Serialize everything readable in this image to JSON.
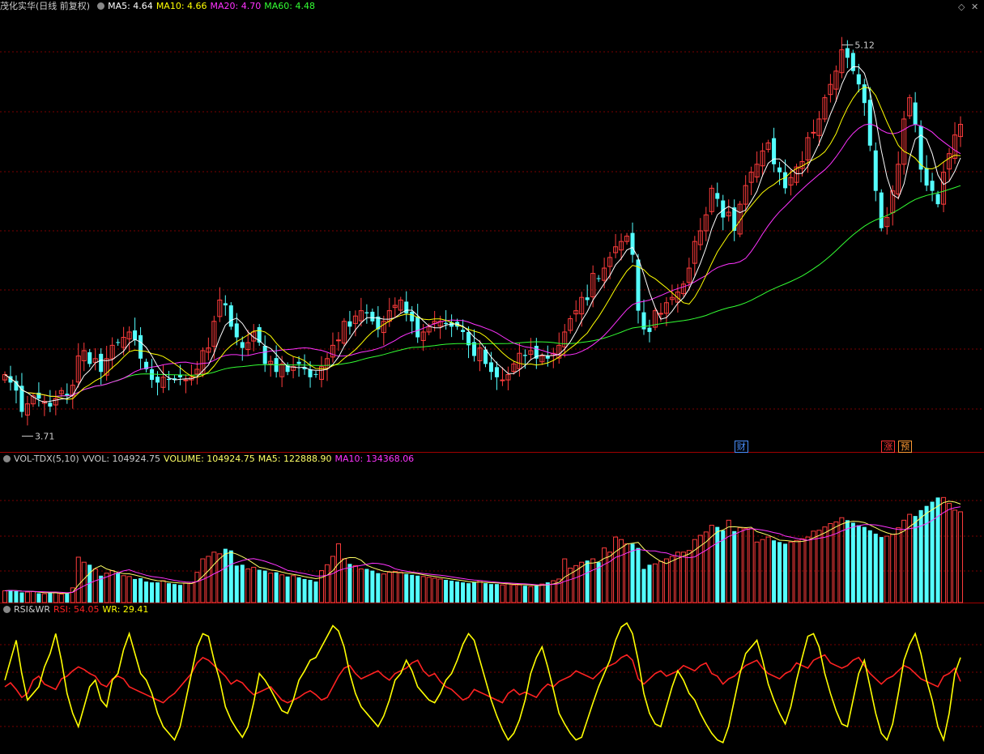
{
  "window_controls": {
    "diamond": "◇",
    "close": "✕"
  },
  "main_panel": {
    "title": "茂化实华(日线 前复权)",
    "ma5": {
      "label": "MA5: 4.64",
      "color": "#ffffff"
    },
    "ma10": {
      "label": "MA10: 4.66",
      "color": "#ffff00"
    },
    "ma20": {
      "label": "MA20: 4.70",
      "color": "#ff33ff"
    },
    "ma60": {
      "label": "MA60: 4.48",
      "color": "#33ff33"
    },
    "high_label": "5.12",
    "low_label": "3.71",
    "markers": [
      {
        "text": "财",
        "color": "#4a90ff",
        "index": 130
      },
      {
        "text": "涨",
        "color": "#ff3333",
        "index": 156
      },
      {
        "text": "预",
        "color": "#ff9933",
        "index": 159
      }
    ]
  },
  "volume_panel": {
    "title": "VOL-TDX(5,10)",
    "vvol": "VVOL: 104924.75",
    "volume": {
      "label": "VOLUME: 104924.75",
      "color": "#ffff66"
    },
    "ma5": {
      "label": "MA5: 122888.90",
      "color": "#ffff66"
    },
    "ma10": {
      "label": "MA10: 134368.06",
      "color": "#ff33ff"
    }
  },
  "rsi_panel": {
    "title": "RSI&WR",
    "rsi": {
      "label": "RSI: 54.05",
      "color": "#ff2222"
    },
    "wr": {
      "label": "WR: 29.41",
      "color": "#ffff00"
    }
  },
  "colors": {
    "up": "#ff3c3c",
    "down": "#54ffff",
    "grid": "#7a0000",
    "separator": "#a00000"
  },
  "chart_data": {
    "type": "candlestick",
    "price_range": [
      3.6,
      5.2
    ],
    "closes": [
      3.86,
      3.83,
      3.8,
      3.72,
      3.75,
      3.78,
      3.77,
      3.76,
      3.74,
      3.77,
      3.8,
      3.78,
      3.82,
      3.93,
      3.95,
      3.9,
      3.92,
      3.87,
      3.92,
      3.97,
      3.98,
      4.0,
      4.02,
      3.99,
      3.92,
      3.88,
      3.84,
      3.83,
      3.85,
      3.84,
      3.84,
      3.85,
      3.84,
      3.85,
      3.88,
      3.95,
      3.96,
      4.06,
      4.14,
      4.12,
      4.04,
      4.0,
      3.96,
      3.98,
      4.02,
      3.98,
      3.9,
      3.91,
      3.87,
      3.9,
      3.87,
      3.89,
      3.9,
      3.88,
      3.85,
      3.86,
      3.89,
      3.92,
      3.97,
      3.99,
      4.06,
      4.04,
      4.08,
      4.1,
      4.09,
      4.06,
      4.03,
      4.06,
      4.1,
      4.12,
      4.14,
      4.09,
      4.06,
      4.0,
      4.02,
      4.04,
      4.06,
      4.06,
      4.05,
      4.04,
      4.04,
      4.02,
      3.97,
      3.93,
      3.96,
      3.9,
      3.87,
      3.85,
      3.84,
      3.86,
      3.9,
      3.94,
      3.93,
      3.95,
      3.92,
      3.93,
      3.92,
      3.94,
      3.97,
      4.02,
      4.07,
      4.1,
      4.15,
      4.14,
      4.24,
      4.22,
      4.26,
      4.3,
      4.34,
      4.36,
      4.38,
      4.31,
      4.1,
      4.03,
      4.02,
      4.1,
      4.09,
      4.13,
      4.15,
      4.17,
      4.2,
      4.26,
      4.36,
      4.4,
      4.46,
      4.56,
      4.52,
      4.45,
      4.47,
      4.4,
      4.5,
      4.57,
      4.62,
      4.65,
      4.7,
      4.73,
      4.65,
      4.62,
      4.56,
      4.6,
      4.64,
      4.66,
      4.75,
      4.77,
      4.82,
      4.9,
      4.95,
      5.0,
      5.08,
      5.05,
      5.0,
      4.95,
      4.88,
      4.72,
      4.55,
      4.41,
      4.45,
      4.55,
      4.65,
      4.82,
      4.9,
      4.8,
      4.63,
      4.57,
      4.55,
      4.5,
      4.62,
      4.69,
      4.76,
      4.8
    ],
    "volume_max": 160000,
    "volumes": [
      14000,
      15000,
      13500,
      12000,
      12500,
      13000,
      11000,
      10500,
      11500,
      12000,
      10000,
      11000,
      17500,
      54000,
      48000,
      45000,
      40000,
      32000,
      35000,
      38000,
      35000,
      32000,
      31000,
      28000,
      29000,
      25000,
      24000,
      24000,
      26000,
      23000,
      22000,
      21000,
      23000,
      24000,
      36000,
      52000,
      55000,
      60000,
      58000,
      64000,
      62000,
      44000,
      45000,
      40000,
      42000,
      39000,
      38000,
      35000,
      36000,
      33000,
      31000,
      32000,
      30000,
      28000,
      27000,
      25000,
      38000,
      45000,
      55000,
      70000,
      52000,
      46000,
      44000,
      40000,
      40000,
      38000,
      35000,
      34000,
      36000,
      37000,
      36000,
      34000,
      33000,
      32000,
      31000,
      30000,
      29000,
      28000,
      27000,
      26000,
      25000,
      24000,
      23000,
      24000,
      26000,
      23000,
      22000,
      22000,
      21000,
      23000,
      21000,
      21000,
      20000,
      19000,
      20000,
      22000,
      24000,
      26000,
      28000,
      52000,
      41000,
      44000,
      48000,
      50000,
      52000,
      48000,
      65000,
      60000,
      78000,
      75000,
      70000,
      70000,
      65000,
      40000,
      45000,
      46000,
      49000,
      52000,
      55000,
      60000,
      60000,
      62000,
      75000,
      80000,
      84000,
      92000,
      90000,
      86000,
      98000,
      85000,
      89000,
      88000,
      88000,
      72000,
      75000,
      78000,
      74000,
      72000,
      70000,
      72000,
      74000,
      76000,
      78000,
      85000,
      86000,
      90000,
      94000,
      96000,
      101000,
      98000,
      95000,
      92000,
      90000,
      86000,
      82000,
      78000,
      79000,
      81000,
      89000,
      98000,
      105000,
      103000,
      110000,
      115000,
      120000,
      125000,
      125000,
      118000,
      110000,
      108000
    ],
    "rsi_range": [
      0,
      100
    ],
    "rsi": [
      50,
      53,
      48,
      42,
      45,
      55,
      58,
      52,
      50,
      48,
      56,
      58,
      62,
      65,
      63,
      60,
      58,
      52,
      50,
      56,
      58,
      56,
      50,
      48,
      46,
      44,
      42,
      40,
      38,
      42,
      45,
      50,
      55,
      60,
      68,
      72,
      70,
      66,
      62,
      58,
      52,
      55,
      53,
      48,
      44,
      46,
      48,
      50,
      45,
      40,
      38,
      40,
      42,
      45,
      47,
      44,
      40,
      42,
      50,
      58,
      64,
      66,
      60,
      56,
      58,
      60,
      62,
      58,
      55,
      60,
      62,
      64,
      68,
      70,
      62,
      58,
      60,
      54,
      50,
      48,
      44,
      40,
      42,
      48,
      46,
      44,
      42,
      40,
      38,
      45,
      48,
      44,
      46,
      44,
      42,
      48,
      52,
      50,
      54,
      56,
      58,
      62,
      60,
      58,
      56,
      60,
      64,
      66,
      68,
      72,
      74,
      70,
      56,
      52,
      56,
      60,
      62,
      58,
      60,
      62,
      66,
      64,
      62,
      66,
      68,
      60,
      58,
      52,
      56,
      58,
      62,
      66,
      68,
      70,
      64,
      60,
      58,
      56,
      60,
      62,
      68,
      66,
      64,
      70,
      72,
      74,
      68,
      66,
      64,
      66,
      70,
      72,
      66,
      60,
      56,
      52,
      56,
      58,
      62,
      66,
      64,
      60,
      56,
      54,
      52,
      50,
      58,
      60,
      64,
      54
    ],
    "wr": [
      55,
      70,
      85,
      60,
      40,
      45,
      50,
      65,
      75,
      90,
      70,
      45,
      30,
      20,
      35,
      50,
      55,
      40,
      35,
      55,
      60,
      78,
      90,
      75,
      60,
      55,
      45,
      30,
      20,
      15,
      10,
      20,
      40,
      60,
      80,
      90,
      88,
      70,
      55,
      35,
      25,
      18,
      12,
      20,
      38,
      60,
      55,
      48,
      40,
      32,
      30,
      40,
      55,
      62,
      70,
      72,
      80,
      88,
      96,
      92,
      80,
      60,
      45,
      35,
      30,
      25,
      20,
      28,
      40,
      55,
      60,
      70,
      62,
      50,
      45,
      40,
      38,
      45,
      55,
      60,
      70,
      82,
      90,
      85,
      70,
      55,
      40,
      28,
      18,
      10,
      15,
      25,
      40,
      60,
      72,
      80,
      65,
      48,
      30,
      22,
      15,
      10,
      12,
      25,
      38,
      50,
      60,
      70,
      85,
      95,
      98,
      90,
      70,
      45,
      30,
      22,
      20,
      35,
      50,
      62,
      55,
      45,
      40,
      30,
      22,
      15,
      10,
      8,
      20,
      40,
      60,
      75,
      80,
      85,
      70,
      52,
      40,
      30,
      22,
      35,
      55,
      72,
      88,
      90,
      80,
      60,
      45,
      32,
      22,
      20,
      40,
      60,
      70,
      50,
      30,
      15,
      10,
      22,
      45,
      70,
      82,
      90,
      75,
      55,
      40,
      20,
      10,
      30,
      60,
      72
    ]
  }
}
